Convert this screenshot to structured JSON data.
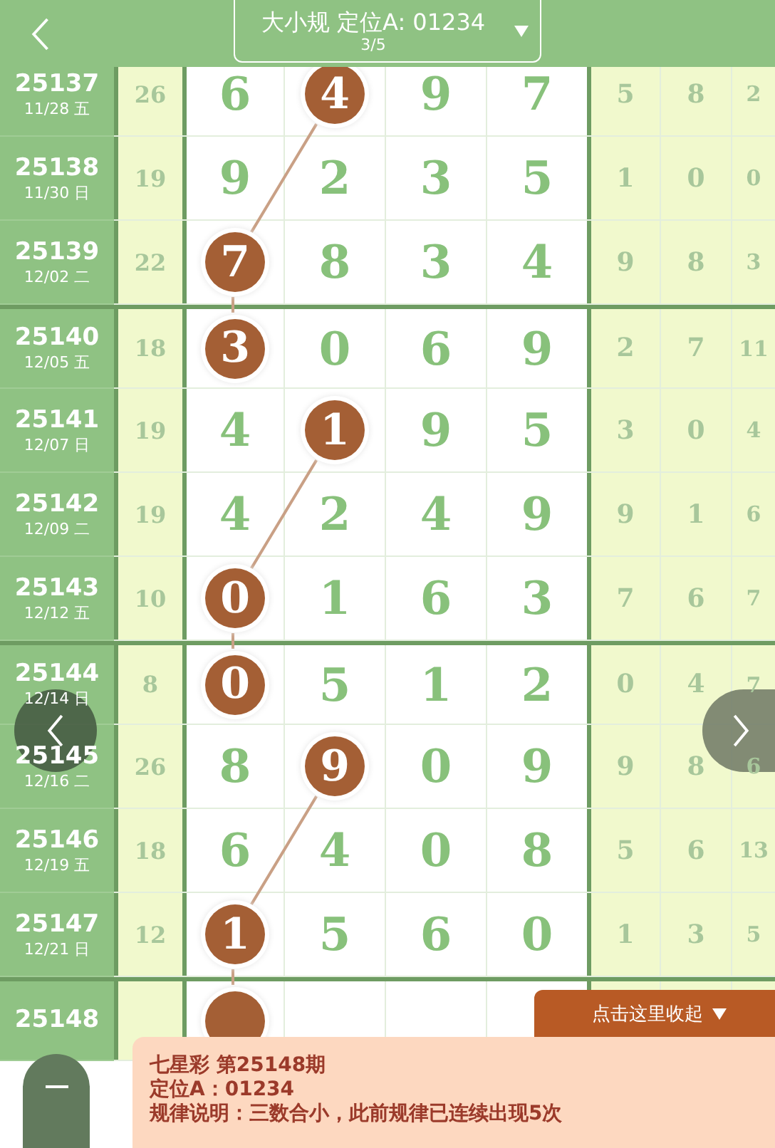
{
  "header": {
    "title": "大小规 定位A: 01234",
    "subtitle": "3/5"
  },
  "rows": [
    {
      "issue": "25137",
      "date": "11/28 五",
      "sum": "26",
      "group_start": false,
      "digits": [
        {
          "value": "6",
          "circled": false
        },
        {
          "value": "4",
          "circled": true
        },
        {
          "value": "9",
          "circled": false
        },
        {
          "value": "7",
          "circled": false
        }
      ],
      "extra": [
        "5",
        "8",
        "2"
      ]
    },
    {
      "issue": "25138",
      "date": "11/30 日",
      "sum": "19",
      "group_start": false,
      "digits": [
        {
          "value": "9",
          "circled": false
        },
        {
          "value": "2",
          "circled": false
        },
        {
          "value": "3",
          "circled": false
        },
        {
          "value": "5",
          "circled": false
        }
      ],
      "extra": [
        "1",
        "0",
        "0"
      ]
    },
    {
      "issue": "25139",
      "date": "12/02 二",
      "sum": "22",
      "group_start": false,
      "digits": [
        {
          "value": "7",
          "circled": true
        },
        {
          "value": "8",
          "circled": false
        },
        {
          "value": "3",
          "circled": false
        },
        {
          "value": "4",
          "circled": false
        }
      ],
      "extra": [
        "9",
        "8",
        "3"
      ]
    },
    {
      "issue": "25140",
      "date": "12/05 五",
      "sum": "18",
      "group_start": true,
      "digits": [
        {
          "value": "3",
          "circled": true
        },
        {
          "value": "0",
          "circled": false
        },
        {
          "value": "6",
          "circled": false
        },
        {
          "value": "9",
          "circled": false
        }
      ],
      "extra": [
        "2",
        "7",
        "11"
      ]
    },
    {
      "issue": "25141",
      "date": "12/07 日",
      "sum": "19",
      "group_start": false,
      "digits": [
        {
          "value": "4",
          "circled": false
        },
        {
          "value": "1",
          "circled": true
        },
        {
          "value": "9",
          "circled": false
        },
        {
          "value": "5",
          "circled": false
        }
      ],
      "extra": [
        "3",
        "0",
        "4"
      ]
    },
    {
      "issue": "25142",
      "date": "12/09 二",
      "sum": "19",
      "group_start": false,
      "digits": [
        {
          "value": "4",
          "circled": false
        },
        {
          "value": "2",
          "circled": false
        },
        {
          "value": "4",
          "circled": false
        },
        {
          "value": "9",
          "circled": false
        }
      ],
      "extra": [
        "9",
        "1",
        "6"
      ]
    },
    {
      "issue": "25143",
      "date": "12/12 五",
      "sum": "10",
      "group_start": false,
      "digits": [
        {
          "value": "0",
          "circled": true
        },
        {
          "value": "1",
          "circled": false
        },
        {
          "value": "6",
          "circled": false
        },
        {
          "value": "3",
          "circled": false
        }
      ],
      "extra": [
        "7",
        "6",
        "7"
      ]
    },
    {
      "issue": "25144",
      "date": "12/14 日",
      "sum": "8",
      "group_start": true,
      "digits": [
        {
          "value": "0",
          "circled": true
        },
        {
          "value": "5",
          "circled": false
        },
        {
          "value": "1",
          "circled": false
        },
        {
          "value": "2",
          "circled": false
        }
      ],
      "extra": [
        "0",
        "4",
        "7"
      ]
    },
    {
      "issue": "25145",
      "date": "12/16 二",
      "sum": "26",
      "group_start": false,
      "digits": [
        {
          "value": "8",
          "circled": false
        },
        {
          "value": "9",
          "circled": true
        },
        {
          "value": "0",
          "circled": false
        },
        {
          "value": "9",
          "circled": false
        }
      ],
      "extra": [
        "9",
        "8",
        "6"
      ]
    },
    {
      "issue": "25146",
      "date": "12/19 五",
      "sum": "18",
      "group_start": false,
      "digits": [
        {
          "value": "6",
          "circled": false
        },
        {
          "value": "4",
          "circled": false
        },
        {
          "value": "0",
          "circled": false
        },
        {
          "value": "8",
          "circled": false
        }
      ],
      "extra": [
        "5",
        "6",
        "13"
      ]
    },
    {
      "issue": "25147",
      "date": "12/21 日",
      "sum": "12",
      "group_start": false,
      "digits": [
        {
          "value": "1",
          "circled": true
        },
        {
          "value": "5",
          "circled": false
        },
        {
          "value": "6",
          "circled": false
        },
        {
          "value": "0",
          "circled": false
        }
      ],
      "extra": [
        "1",
        "3",
        "5"
      ]
    },
    {
      "issue": "25148",
      "group_start": true,
      "digits": [
        {
          "circled": true
        }
      ]
    }
  ],
  "collapse_tab": {
    "label": "点击这里收起"
  },
  "info_panel": {
    "lines": [
      "七星彩 第25148期",
      "定位A：01234",
      "规律说明：三数合小，此前规律已连续出现5次"
    ]
  }
}
